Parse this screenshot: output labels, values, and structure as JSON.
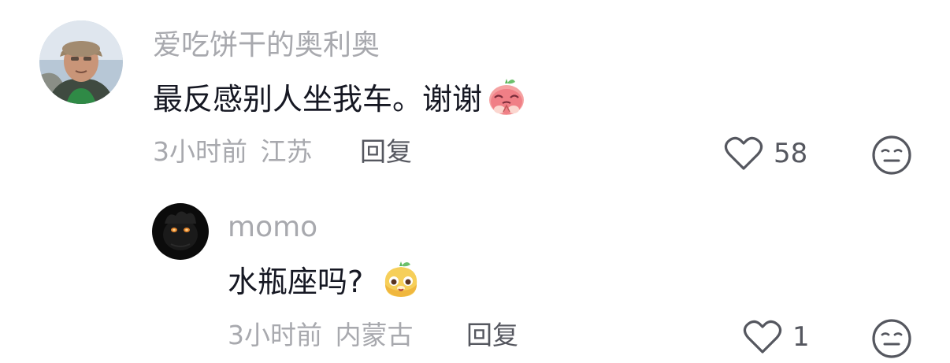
{
  "comments": [
    {
      "username": "爱吃饼干的奥利奥",
      "text": "最反感别人坐我车。谢谢",
      "emoji": "emoji-shy",
      "time": "3小时前",
      "location": "江苏",
      "reply_label": "回复",
      "likes": "58"
    },
    {
      "username": "momo",
      "text": "水瓶座吗?",
      "emoji": "emoji-curious",
      "time": "3小时前",
      "location": "内蒙古",
      "reply_label": "回复",
      "likes": "1"
    }
  ],
  "colors": {
    "primary_text": "#161823",
    "secondary_text": "#a8a9ae",
    "action_text": "#55575f"
  },
  "icons": {
    "like": "heart-outline-icon",
    "dislike": "neutral-face-icon"
  }
}
